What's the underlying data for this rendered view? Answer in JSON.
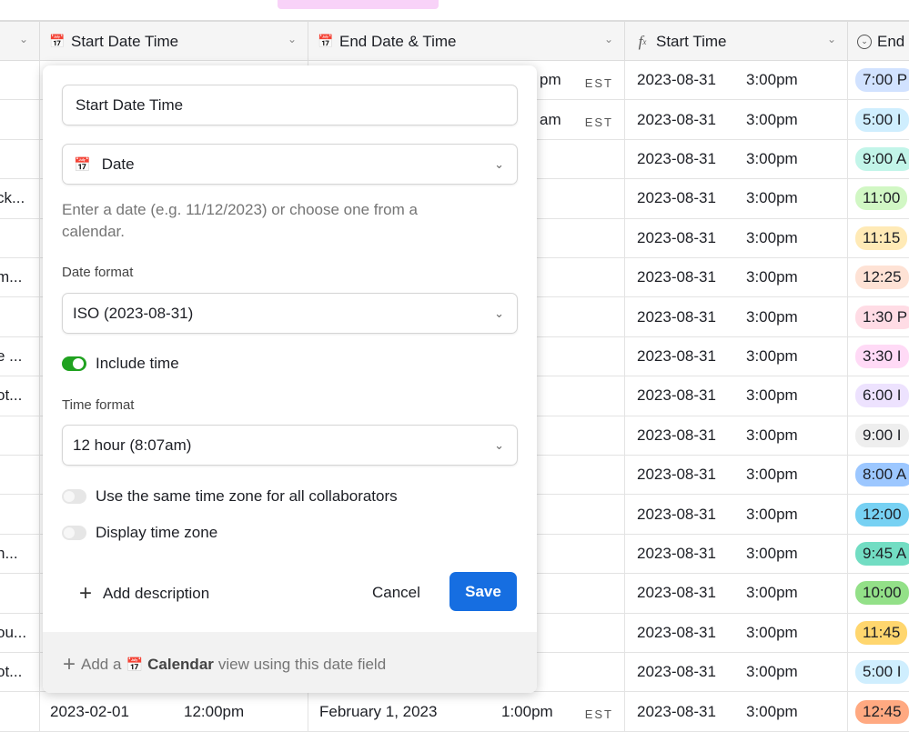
{
  "header": {
    "columns": [
      {
        "label": "",
        "icon": "chevron-down-icon"
      },
      {
        "label": "Start Date Time",
        "icon": "calendar-icon"
      },
      {
        "label": "End Date & Time",
        "icon": "calendar-icon"
      },
      {
        "label": "Start Time",
        "icon": "formula-icon"
      },
      {
        "label": "End",
        "icon": "dropdown-circle-icon"
      }
    ]
  },
  "rows": [
    {
      "c0": "",
      "end_partial": "pm",
      "tz": "EST",
      "start_date": "2023-08-31",
      "start_time": "3:00pm",
      "pill": "7:00 P",
      "pill_color": "#d1e2ff"
    },
    {
      "c0": "",
      "end_partial": "am",
      "tz": "EST",
      "start_date": "2023-08-31",
      "start_time": "3:00pm",
      "pill": "5:00 I",
      "pill_color": "#cfeefe"
    },
    {
      "c0": "",
      "start_date": "2023-08-31",
      "start_time": "3:00pm",
      "pill": "9:00 A",
      "pill_color": "#c2f5e9"
    },
    {
      "c0": "ck...",
      "start_date": "2023-08-31",
      "start_time": "3:00pm",
      "pill": "11:00",
      "pill_color": "#d1f7c4"
    },
    {
      "c0": "",
      "start_date": "2023-08-31",
      "start_time": "3:00pm",
      "pill": "11:15",
      "pill_color": "#ffeab6"
    },
    {
      "c0": "m...",
      "start_date": "2023-08-31",
      "start_time": "3:00pm",
      "pill": "12:25",
      "pill_color": "#fee2d5"
    },
    {
      "c0": "",
      "start_date": "2023-08-31",
      "start_time": "3:00pm",
      "pill": "1:30 P",
      "pill_color": "#ffdce5"
    },
    {
      "c0": "e ...",
      "start_date": "2023-08-31",
      "start_time": "3:00pm",
      "pill": "3:30 I",
      "pill_color": "#ffdaf6"
    },
    {
      "c0": "ot...",
      "start_date": "2023-08-31",
      "start_time": "3:00pm",
      "pill": "6:00 I",
      "pill_color": "#ede2fe"
    },
    {
      "c0": "",
      "start_date": "2023-08-31",
      "start_time": "3:00pm",
      "pill": "9:00 I",
      "pill_color": "#eeeeee"
    },
    {
      "c0": "",
      "start_date": "2023-08-31",
      "start_time": "3:00pm",
      "pill": "8:00 A",
      "pill_color": "#9cc7ff"
    },
    {
      "c0": "",
      "start_date": "2023-08-31",
      "start_time": "3:00pm",
      "pill": "12:00",
      "pill_color": "#77d1f3"
    },
    {
      "c0": "n...",
      "start_date": "2023-08-31",
      "start_time": "3:00pm",
      "pill": "9:45 A",
      "pill_color": "#72ddc3"
    },
    {
      "c0": "",
      "start_date": "2023-08-31",
      "start_time": "3:00pm",
      "pill": "10:00",
      "pill_color": "#93e088"
    },
    {
      "c0": "ou...",
      "start_date": "2023-08-31",
      "start_time": "3:00pm",
      "pill": "11:45",
      "pill_color": "#ffd66e"
    },
    {
      "c0": "ot...",
      "start_date": "2023-08-31",
      "start_time": "3:00pm",
      "pill": "5:00 I",
      "pill_color": "#cfeefe"
    },
    {
      "c0": "",
      "date1": "2023-02-01",
      "time1": "12:00pm",
      "date2": "February 1, 2023",
      "time2": "1:00pm",
      "tz": "EST",
      "start_date": "2023-08-31",
      "start_time": "3:00pm",
      "pill": "12:45",
      "pill_color": "#ffa981"
    }
  ],
  "popup": {
    "name_value": "Start Date Time",
    "type_value": "Date",
    "help_text": "Enter a date (e.g. 11/12/2023) or choose one from a calendar.",
    "date_format_label": "Date format",
    "date_format_value": "ISO (2023-08-31)",
    "include_time_label": "Include time",
    "include_time_on": true,
    "time_format_label": "Time format",
    "time_format_value": "12 hour (8:07am)",
    "same_tz_label": "Use the same time zone for all collaborators",
    "same_tz_on": false,
    "display_tz_label": "Display time zone",
    "display_tz_on": false,
    "add_description": "Add description",
    "cancel": "Cancel",
    "save": "Save",
    "footer": {
      "prefix": "Add a",
      "calendar": "Calendar",
      "suffix": "view using this date field"
    }
  },
  "colors": {
    "accent": "#166ee1",
    "toggle_on": "#20a220",
    "calendar_icon": "#e0541a"
  }
}
